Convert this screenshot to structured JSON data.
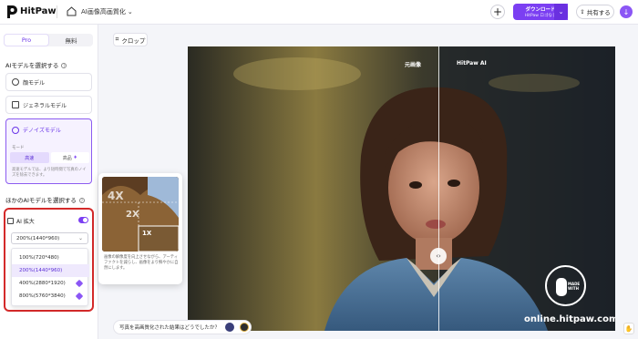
{
  "header": {
    "logo_text": "HitPaw",
    "breadcrumb": "AI画像高画質化",
    "download_label": "ダウンロード",
    "download_sub": "HitPaw ロゴなし",
    "share_label": "共有する"
  },
  "sidebar": {
    "tabs": [
      {
        "label": "Pro",
        "active": true
      },
      {
        "label": "無料",
        "active": false
      }
    ],
    "model_section_label": "AIモデルを選択する",
    "models": [
      {
        "label": "顔モデル",
        "icon": "face-icon"
      },
      {
        "label": "ジェネラルモデル",
        "icon": "image-icon"
      },
      {
        "label": "デノイズモデル",
        "icon": "denoise-icon",
        "selected": true
      }
    ],
    "mode_label": "モード",
    "modes": [
      "高速",
      "高品"
    ],
    "mode_active": "高速",
    "mode_description": "高速モデルでは、より短時間で写真のノイズを除去できます。",
    "other_section_label": "ほかのAIモデルを選択する",
    "ai_upscale": {
      "label": "AI 拡大",
      "enabled": true,
      "selected_value": "200%(1440*960)",
      "options": [
        {
          "label": "100%(720*480)",
          "pro": false
        },
        {
          "label": "200%(1440*960)",
          "pro": false,
          "selected": true
        },
        {
          "label": "400%(2880*1920)",
          "pro": true
        },
        {
          "label": "800%(5760*3840)",
          "pro": true
        }
      ]
    }
  },
  "canvas": {
    "crop_label": "クロップ",
    "label_original": "元画像",
    "label_enhanced": "HitPaw AI",
    "handle_symbol": "‹›",
    "watermark_url": "online.hitpaw.com",
    "made_with": "MADE WITH"
  },
  "tooltip": {
    "zoom_4x": "4X",
    "zoom_2x": "2X",
    "zoom_1x": "1X",
    "description": "画像の解像度を向上させながら、アーティファクトを減らし、画像をより鮮やかに自然にします。"
  },
  "feedback": {
    "question": "写真を高画質化された結果はどうでしたか？"
  },
  "colors": {
    "accent": "#7b3ff2",
    "highlight_border": "#d42a2a",
    "selected_bg": "#efe9fd"
  }
}
